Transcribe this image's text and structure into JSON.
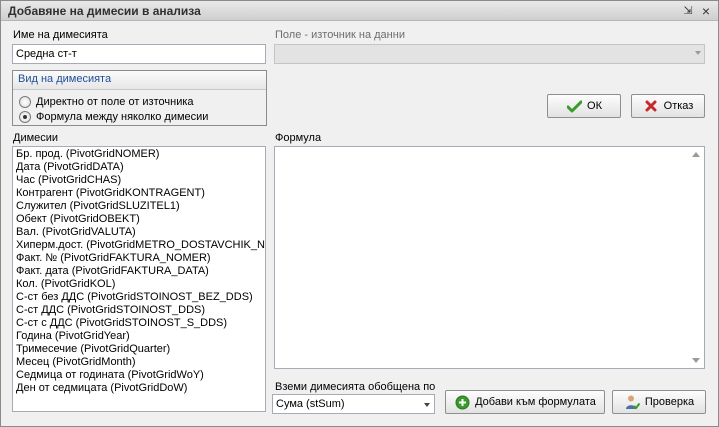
{
  "window": {
    "title": "Добавяне на димесии в анализа",
    "pin_glyph": "⇲",
    "close_glyph": "×"
  },
  "dimension_name": {
    "label": "Име на димесията",
    "value": "Средна ст-т"
  },
  "data_source": {
    "label": "Поле - източник на данни",
    "value": ""
  },
  "dimension_type": {
    "header": "Вид на димесията",
    "options": [
      {
        "label": "Директно от поле от източника",
        "checked": false
      },
      {
        "label": "Формула между няколко димесии",
        "checked": true
      }
    ]
  },
  "buttons": {
    "ok": "ОК",
    "cancel": "Отказ",
    "add_to_formula": "Добави към формулата",
    "check": "Проверка"
  },
  "dimensions_list": {
    "label": "Димесии",
    "items": [
      "Бр. прод. (PivotGridNOMER)",
      "Дата (PivotGridDATA)",
      "Час (PivotGridCHAS)",
      "Контрагент (PivotGridKONTRAGENT)",
      "Служител (PivotGridSLUZITEL1)",
      "Обект (PivotGridOBEKT)",
      "Вал. (PivotGridVALUTA)",
      "Хиперм.дост. (PivotGridMETRO_DOSTAVCHIK_NOM",
      "Факт. № (PivotGridFAKTURA_NOMER)",
      "Факт. дата (PivotGridFAKTURA_DATA)",
      "Кол. (PivotGridKOL)",
      "С-ст без ДДС (PivotGridSTOINOST_BEZ_DDS)",
      "С-ст ДДС (PivotGridSTOINOST_DDS)",
      "С-ст с ДДС (PivotGridSTOINOST_S_DDS)",
      "Година (PivotGridYear)",
      "Тримесечие (PivotGridQuarter)",
      "Месец (PivotGridMonth)",
      "Седмица от годината (PivotGridWoY)",
      "Ден от седмицата (PivotGridDoW)"
    ]
  },
  "formula": {
    "label": "Формула",
    "value": ""
  },
  "aggregation": {
    "label": "Вземи димесията обобщена по",
    "value": "Сума (stSum)"
  },
  "colors": {
    "group_header_text": "#1f4e99",
    "ok_icon": "#3a9a2b",
    "cancel_icon": "#c8282a",
    "add_icon": "#3a9a2b"
  },
  "icons": {
    "ok": "check-icon",
    "cancel": "cross-icon",
    "add": "plus-circle-icon",
    "check": "user-check-icon"
  }
}
